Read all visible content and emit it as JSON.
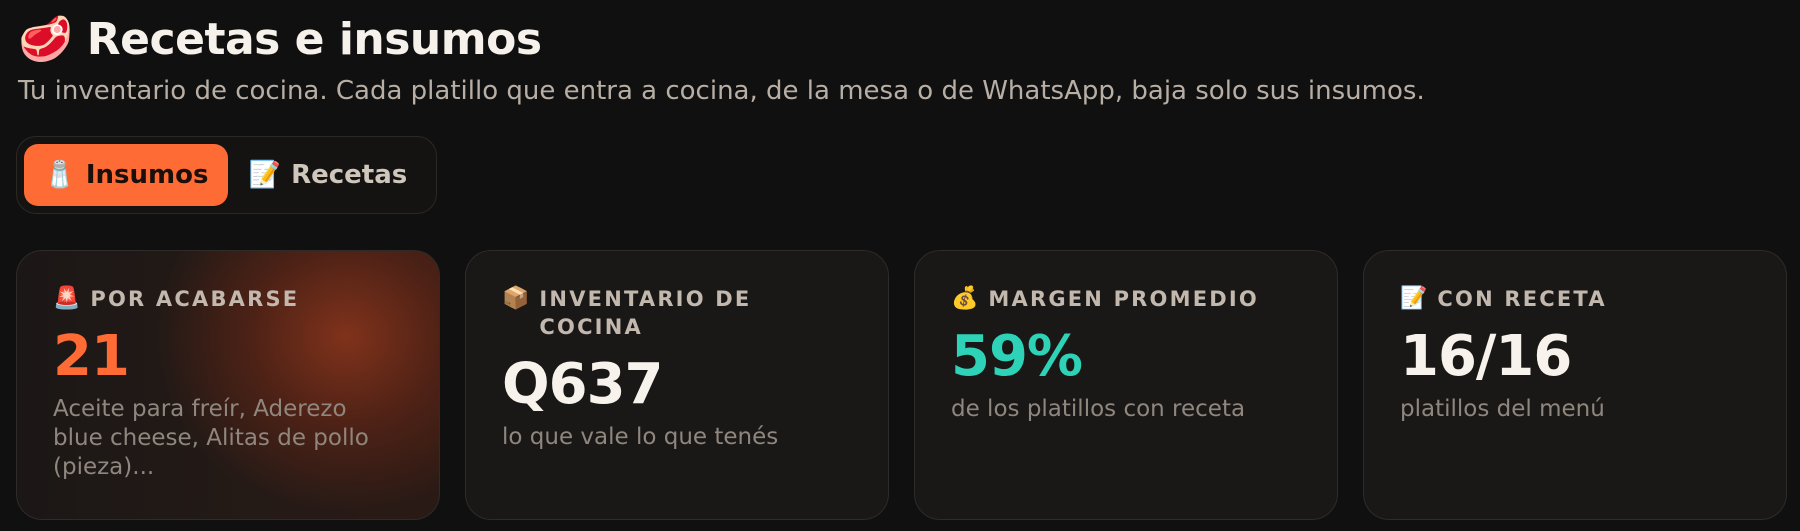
{
  "header": {
    "icon": "🥩",
    "title": "Recetas e insumos",
    "subtitle": "Tu inventario de cocina. Cada platillo que entra a cocina, de la mesa o de WhatsApp, baja solo sus insumos."
  },
  "tabs": [
    {
      "icon": "🧂",
      "label": "Insumos",
      "active": true
    },
    {
      "icon": "📝",
      "label": "Recetas",
      "active": false
    }
  ],
  "cards": {
    "low_stock": {
      "icon": "🚨",
      "label": "POR ACABARSE",
      "value": "21",
      "sub": "Aceite para freír, Aderezo blue cheese, Alitas de pollo (pieza)..."
    },
    "inventory": {
      "icon": "📦",
      "label": "INVENTARIO DE COCINA",
      "value": "Q637",
      "sub": "lo que vale lo que tenés"
    },
    "margin": {
      "icon": "💰",
      "label": "MARGEN PROMEDIO",
      "value": "59%",
      "sub": "de los platillos con receta"
    },
    "recipes": {
      "icon": "📝",
      "label": "CON RECETA",
      "value": "16/16",
      "sub": "platillos del menú"
    }
  },
  "colors": {
    "accent": "#ff6b35",
    "teal": "#2ed3b7",
    "background": "#111010"
  }
}
